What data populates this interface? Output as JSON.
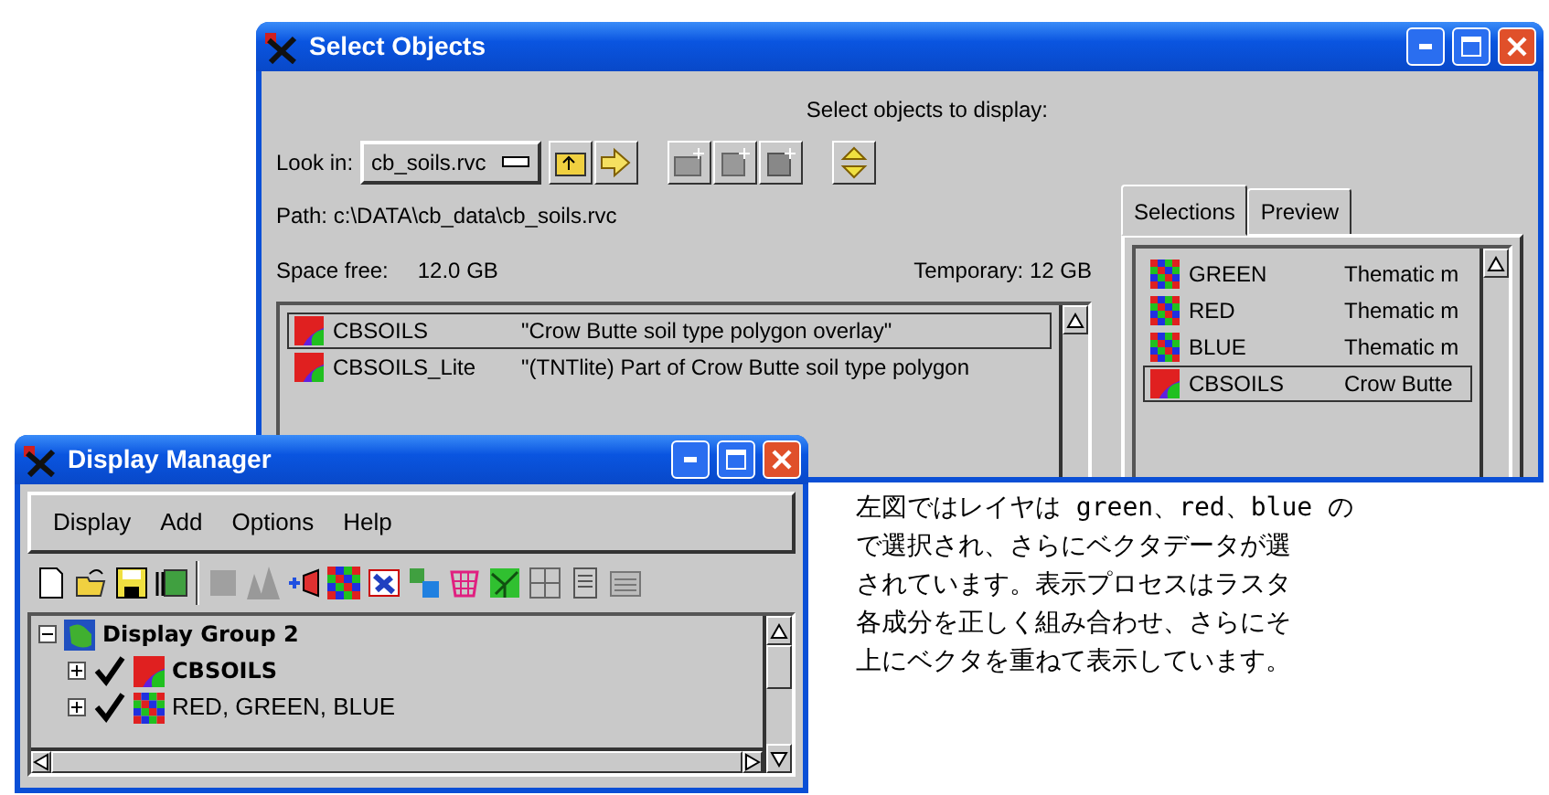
{
  "select_window": {
    "title": "Select Objects",
    "prompt": "Select objects to display:",
    "look_in_label": "Look in:",
    "look_in_value": "cb_soils.rvc",
    "path": "Path: c:\\DATA\\cb_data\\cb_soils.rvc",
    "space_free_label": "Space free:",
    "space_free_value": "12.0 GB",
    "temporary": "Temporary: 12 GB",
    "objects": [
      {
        "name": "CBSOILS",
        "description": "\"Crow Butte soil type polygon overlay\"",
        "selected": true,
        "kind": "vector"
      },
      {
        "name": "CBSOILS_Lite",
        "description": "\"(TNTlite) Part of Crow Butte soil type polygon",
        "selected": false,
        "kind": "vector"
      }
    ],
    "tabs": [
      {
        "label": "Selections",
        "selected": true
      },
      {
        "label": "Preview",
        "selected": false
      }
    ],
    "selections": [
      {
        "name": "GREEN",
        "description": "Thematic m",
        "selected": false,
        "kind": "raster"
      },
      {
        "name": "RED",
        "description": "Thematic m",
        "selected": false,
        "kind": "raster"
      },
      {
        "name": "BLUE",
        "description": "Thematic m",
        "selected": false,
        "kind": "raster"
      },
      {
        "name": "CBSOILS",
        "description": "Crow Butte",
        "selected": true,
        "kind": "vector"
      }
    ]
  },
  "display_manager": {
    "title": "Display Manager",
    "menu": [
      "Display",
      "Add",
      "Options",
      "Help"
    ],
    "tree": [
      {
        "label": "Display Group 2",
        "expanded": true,
        "kind": "group",
        "children": [
          {
            "label": "CBSOILS",
            "checked": true,
            "expanded": false,
            "kind": "vector"
          },
          {
            "label": "RED, GREEN, BLUE",
            "checked": true,
            "expanded": false,
            "kind": "raster"
          }
        ]
      }
    ]
  },
  "note": {
    "lines": [
      "左図ではレイヤは green、red、blue の",
      "で選択され、さらにベクタデータが選",
      "されています。表示プロセスはラスタ",
      "各成分を正しく組み合わせ、さらにそ",
      "上にベクタを重ねて表示しています。"
    ]
  }
}
